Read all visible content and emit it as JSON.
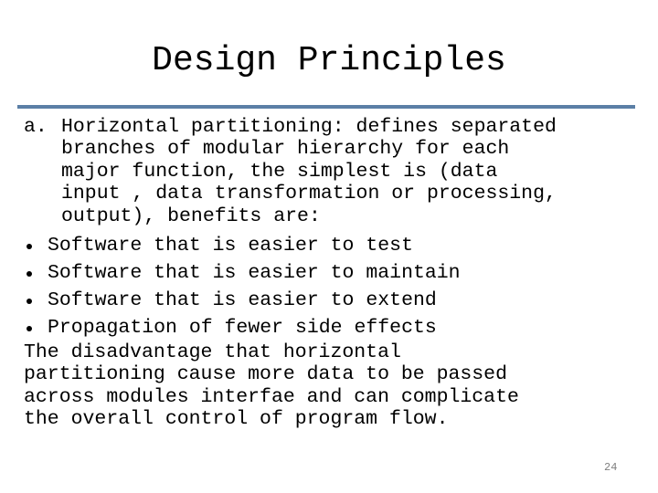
{
  "slide": {
    "title": "Design Principles",
    "accent_color": "#5b7fa6",
    "page_number": "24",
    "item_a": {
      "marker": "a.",
      "lines": [
        "Horizontal partitioning: defines separated",
        "branches of modular hierarchy for each",
        "major function, the simplest is (data",
        "input , data transformation or processing,",
        "output), benefits are:"
      ]
    },
    "bullets": [
      "Software that is easier to test",
      "Software that is easier to maintain",
      "Software that is easier to extend",
      "Propagation of fewer side effects"
    ],
    "closing_lines": [
      "The disadvantage that horizontal",
      "partitioning cause more data to be passed",
      "across modules interfae and can complicate",
      "the overall control of program flow."
    ]
  }
}
